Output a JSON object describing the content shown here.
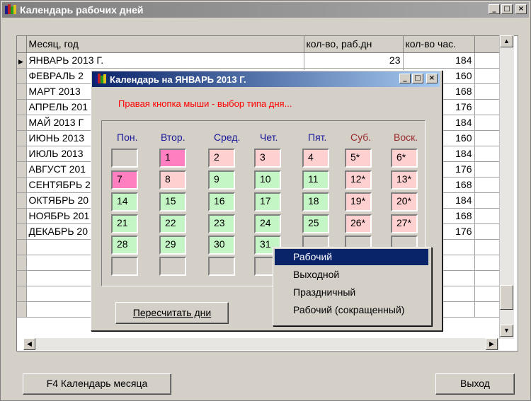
{
  "main_window": {
    "title": "Календарь рабочих дней"
  },
  "grid": {
    "headers": {
      "month": "Месяц, год",
      "workdays": "кол-во, раб.дн",
      "hours": "кол-во час."
    },
    "rows": [
      {
        "month": "ЯНВАРЬ 2013 Г.",
        "workdays": "23",
        "hours": "184"
      },
      {
        "month": "ФЕВРАЛЬ 2",
        "workdays": "",
        "hours": "160"
      },
      {
        "month": "МАРТ 2013",
        "workdays": "",
        "hours": "168"
      },
      {
        "month": "АПРЕЛЬ 201",
        "workdays": "",
        "hours": "176"
      },
      {
        "month": "МАЙ 2013 Г",
        "workdays": "",
        "hours": "184"
      },
      {
        "month": "ИЮНЬ 2013",
        "workdays": "",
        "hours": "160"
      },
      {
        "month": "ИЮЛЬ 2013",
        "workdays": "",
        "hours": "184"
      },
      {
        "month": "АВГУСТ 201",
        "workdays": "",
        "hours": "176"
      },
      {
        "month": "СЕНТЯБРЬ 2",
        "workdays": "",
        "hours": "168"
      },
      {
        "month": "ОКТЯБРЬ 20",
        "workdays": "",
        "hours": "184"
      },
      {
        "month": "НОЯБРЬ 201",
        "workdays": "",
        "hours": "168"
      },
      {
        "month": "ДЕКАБРЬ 20",
        "workdays": "",
        "hours": "176"
      }
    ]
  },
  "buttons": {
    "calendar": "F4 Календарь месяца",
    "exit": "Выход"
  },
  "dialog": {
    "title": "Календарь на ЯНВАРЬ 2013 Г.",
    "hint": "Правая кнопка мыши - выбор типа дня...",
    "days": [
      "Пон.",
      "Втор.",
      "Сред.",
      "Чет.",
      "Пят.",
      "Суб.",
      "Воск."
    ],
    "recalc": "Пересчитать дни"
  },
  "calendar": [
    [
      "",
      "1",
      "2",
      "3",
      "4",
      "5*",
      "6*"
    ],
    [
      "7",
      "8",
      "9",
      "10",
      "11",
      "12*",
      "13*"
    ],
    [
      "14",
      "15",
      "16",
      "17",
      "18",
      "19*",
      "20*"
    ],
    [
      "21",
      "22",
      "23",
      "24",
      "25",
      "26*",
      "27*"
    ],
    [
      "28",
      "29",
      "30",
      "31",
      "",
      "",
      ""
    ],
    [
      "",
      "",
      "",
      "",
      "",
      "",
      ""
    ]
  ],
  "context_menu": {
    "items": [
      "Рабочий",
      "Выходной",
      "Праздничный",
      "Рабочий (сокращенный)"
    ],
    "selected": 0
  },
  "colors": {
    "workday": "#c4f5c4",
    "holiday": "#ffd0d0",
    "selected_day": "#ff7fc0",
    "weekday_header": "#1a1a9a",
    "weekend_header": "#9a2a2a",
    "hint": "#ff0000"
  }
}
